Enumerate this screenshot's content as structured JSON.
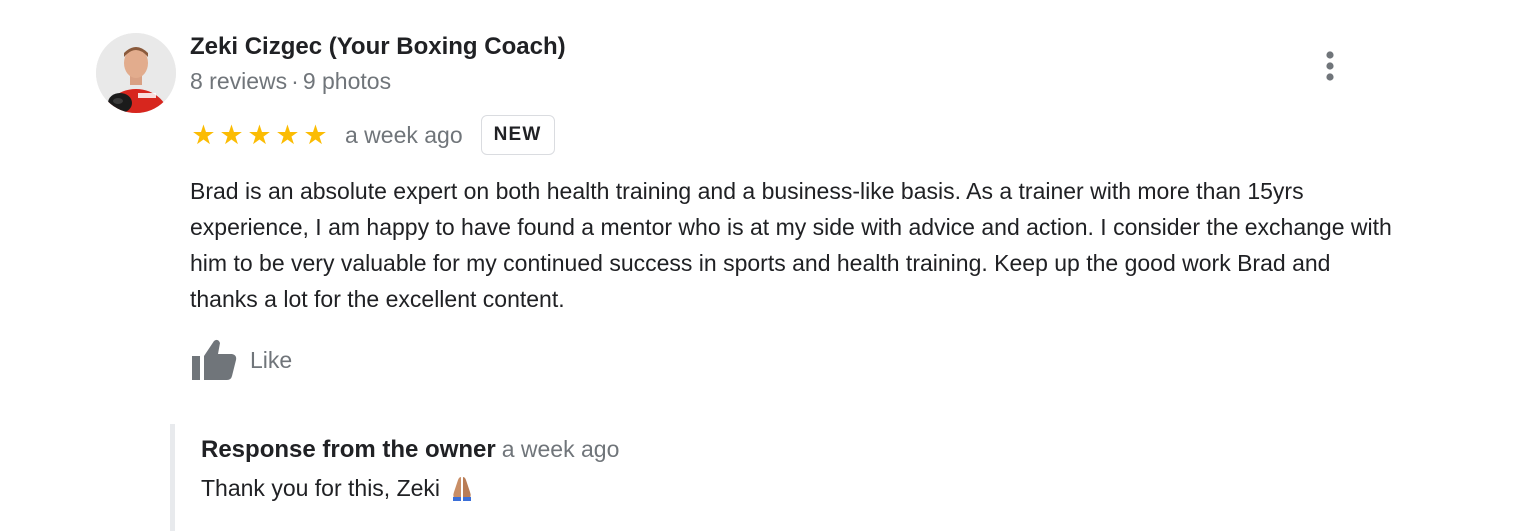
{
  "review": {
    "author": {
      "name": "Zeki Cizgec (Your Boxing Coach)",
      "reviews_count": "8 reviews",
      "separator": "·",
      "photos_count": "9 photos",
      "avatar_icon": "profile-photo"
    },
    "menu_icon": "more-vert-icon",
    "rating": {
      "stars": 5,
      "max": 5,
      "star_glyph": "★",
      "color": "#fbbc04"
    },
    "time_ago": "a week ago",
    "badge": "NEW",
    "text": "Brad is an absolute expert on both health training and a business-like basis. As a trainer with more than 15yrs experience, I am happy to have found a mentor who is at my side with advice and action. I consider the exchange with him to be very valuable for my continued success in sports and health training.  Keep up the good work Brad and thanks a lot for the excellent content.",
    "like": {
      "label": "Like",
      "icon": "thumbs-up-icon"
    },
    "owner_response": {
      "title": "Response from the owner",
      "time_ago": "a week ago",
      "text": "Thank you for this, Zeki",
      "emoji_icon": "folded-hands-icon"
    }
  },
  "colors": {
    "primary_text": "#202124",
    "secondary_text": "#70757a",
    "star": "#fbbc04",
    "badge_border": "#dadce0",
    "response_border": "#e8eaed"
  }
}
